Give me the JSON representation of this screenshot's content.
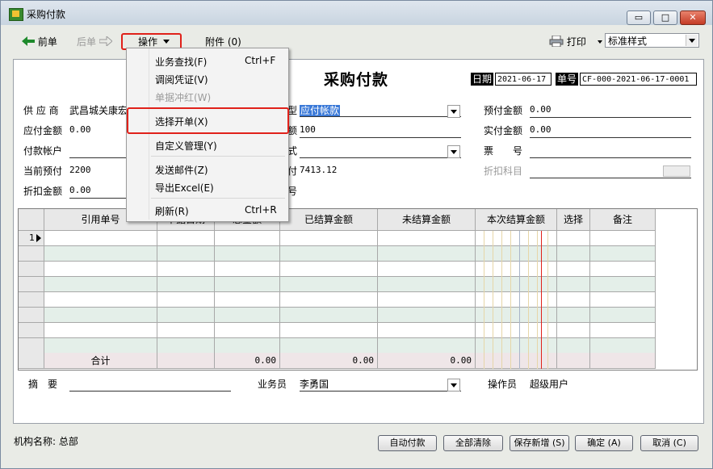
{
  "window": {
    "title": "采购付款",
    "minimize_label": "▭",
    "maximize_label": "□",
    "close_label": "✕"
  },
  "toolbar": {
    "prev_label": "前单",
    "next_label": "后单",
    "operate_label": "操作",
    "attach_label": "附件 (0)",
    "print_label": "打印",
    "style_value": "标准样式"
  },
  "menu": {
    "items": [
      {
        "label": "业务查找(F)",
        "shortcut": "Ctrl+F",
        "enabled": true
      },
      {
        "label": "调阅凭证(V)",
        "shortcut": "",
        "enabled": true
      },
      {
        "label": "单据冲红(W)",
        "shortcut": "",
        "enabled": false
      },
      {
        "label": "选择开单(X)",
        "shortcut": "",
        "enabled": true
      },
      {
        "label": "自定义管理(Y)",
        "shortcut": "",
        "enabled": true
      },
      {
        "label": "发送邮件(Z)",
        "shortcut": "",
        "enabled": true
      },
      {
        "label": "导出Excel(E)",
        "shortcut": "",
        "enabled": true
      },
      {
        "label": "刷新(R)",
        "shortcut": "Ctrl+R",
        "enabled": true
      }
    ]
  },
  "form": {
    "title": "采购付款",
    "date_label": "日期",
    "date_value": "2021-06-17",
    "doc_no_label": "单号",
    "doc_no_value": "CF-000-2021-06-17-0001",
    "supplier_label": "供 应 商",
    "supplier_value": "武昌城关康宏",
    "payable_label": "应付金额",
    "payable_value": "0.00",
    "account_label": "付款帐户",
    "account_value": "",
    "current_prepay_label": "当前预付",
    "current_prepay_value": "2200",
    "discount_label": "折扣金额",
    "discount_value": "0.00",
    "type_label": "型",
    "type_value": "应付帐款",
    "amount_label": "额",
    "amount_value": "100",
    "settle_label": "式",
    "settle_value": "",
    "current_pay_label": "付",
    "current_pay_value": "7413.12",
    "number_label": "号",
    "prepaid_label": "预付金额",
    "prepaid_value": "0.00",
    "actual_label": "实付金额",
    "actual_value": "0.00",
    "ticket_label": "票　　号",
    "ticket_value": "",
    "discount_subject_label": "折扣科目",
    "discount_subject_value": ""
  },
  "grid": {
    "columns": [
      "引用单号",
      "单据日期",
      "总金额",
      "已结算金额",
      "未结算金额",
      "本次结算金额",
      "选择",
      "备注"
    ],
    "first_row_number": "1",
    "total_label": "合计",
    "totals": [
      "0.00",
      "0.00",
      "0.00"
    ]
  },
  "footer": {
    "summary_label": "摘　要",
    "summary_value": "",
    "salesman_label": "业务员",
    "salesman_value": "李勇国",
    "operator_label": "操作员",
    "operator_value": "超级用户"
  },
  "status": {
    "org_label": "机构名称: 总部"
  },
  "buttons": {
    "auto_pay": "自动付款",
    "clear_all": "全部清除",
    "save_new": "保存新增 (S)",
    "confirm": "确定 (A)",
    "cancel": "取消 (C)"
  }
}
